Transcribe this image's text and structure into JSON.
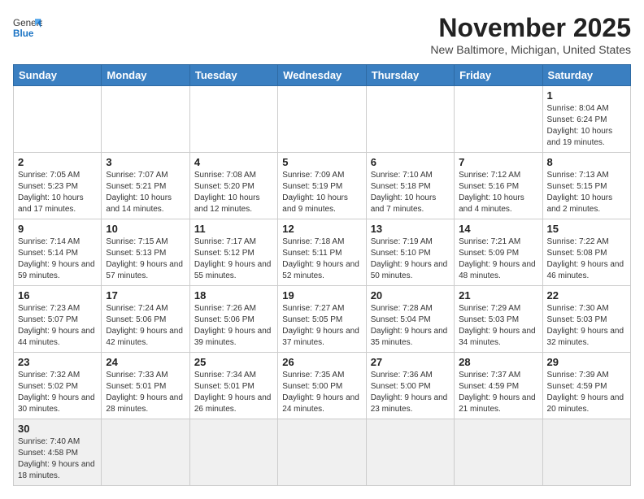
{
  "header": {
    "logo_text_normal": "General",
    "logo_text_bold": "Blue",
    "month": "November 2025",
    "location": "New Baltimore, Michigan, United States"
  },
  "weekdays": [
    "Sunday",
    "Monday",
    "Tuesday",
    "Wednesday",
    "Thursday",
    "Friday",
    "Saturday"
  ],
  "weeks": [
    [
      {
        "day": "",
        "info": ""
      },
      {
        "day": "",
        "info": ""
      },
      {
        "day": "",
        "info": ""
      },
      {
        "day": "",
        "info": ""
      },
      {
        "day": "",
        "info": ""
      },
      {
        "day": "",
        "info": ""
      },
      {
        "day": "1",
        "info": "Sunrise: 8:04 AM\nSunset: 6:24 PM\nDaylight: 10 hours and 19 minutes."
      }
    ],
    [
      {
        "day": "2",
        "info": "Sunrise: 7:05 AM\nSunset: 5:23 PM\nDaylight: 10 hours and 17 minutes."
      },
      {
        "day": "3",
        "info": "Sunrise: 7:07 AM\nSunset: 5:21 PM\nDaylight: 10 hours and 14 minutes."
      },
      {
        "day": "4",
        "info": "Sunrise: 7:08 AM\nSunset: 5:20 PM\nDaylight: 10 hours and 12 minutes."
      },
      {
        "day": "5",
        "info": "Sunrise: 7:09 AM\nSunset: 5:19 PM\nDaylight: 10 hours and 9 minutes."
      },
      {
        "day": "6",
        "info": "Sunrise: 7:10 AM\nSunset: 5:18 PM\nDaylight: 10 hours and 7 minutes."
      },
      {
        "day": "7",
        "info": "Sunrise: 7:12 AM\nSunset: 5:16 PM\nDaylight: 10 hours and 4 minutes."
      },
      {
        "day": "8",
        "info": "Sunrise: 7:13 AM\nSunset: 5:15 PM\nDaylight: 10 hours and 2 minutes."
      }
    ],
    [
      {
        "day": "9",
        "info": "Sunrise: 7:14 AM\nSunset: 5:14 PM\nDaylight: 9 hours and 59 minutes."
      },
      {
        "day": "10",
        "info": "Sunrise: 7:15 AM\nSunset: 5:13 PM\nDaylight: 9 hours and 57 minutes."
      },
      {
        "day": "11",
        "info": "Sunrise: 7:17 AM\nSunset: 5:12 PM\nDaylight: 9 hours and 55 minutes."
      },
      {
        "day": "12",
        "info": "Sunrise: 7:18 AM\nSunset: 5:11 PM\nDaylight: 9 hours and 52 minutes."
      },
      {
        "day": "13",
        "info": "Sunrise: 7:19 AM\nSunset: 5:10 PM\nDaylight: 9 hours and 50 minutes."
      },
      {
        "day": "14",
        "info": "Sunrise: 7:21 AM\nSunset: 5:09 PM\nDaylight: 9 hours and 48 minutes."
      },
      {
        "day": "15",
        "info": "Sunrise: 7:22 AM\nSunset: 5:08 PM\nDaylight: 9 hours and 46 minutes."
      }
    ],
    [
      {
        "day": "16",
        "info": "Sunrise: 7:23 AM\nSunset: 5:07 PM\nDaylight: 9 hours and 44 minutes."
      },
      {
        "day": "17",
        "info": "Sunrise: 7:24 AM\nSunset: 5:06 PM\nDaylight: 9 hours and 42 minutes."
      },
      {
        "day": "18",
        "info": "Sunrise: 7:26 AM\nSunset: 5:06 PM\nDaylight: 9 hours and 39 minutes."
      },
      {
        "day": "19",
        "info": "Sunrise: 7:27 AM\nSunset: 5:05 PM\nDaylight: 9 hours and 37 minutes."
      },
      {
        "day": "20",
        "info": "Sunrise: 7:28 AM\nSunset: 5:04 PM\nDaylight: 9 hours and 35 minutes."
      },
      {
        "day": "21",
        "info": "Sunrise: 7:29 AM\nSunset: 5:03 PM\nDaylight: 9 hours and 34 minutes."
      },
      {
        "day": "22",
        "info": "Sunrise: 7:30 AM\nSunset: 5:03 PM\nDaylight: 9 hours and 32 minutes."
      }
    ],
    [
      {
        "day": "23",
        "info": "Sunrise: 7:32 AM\nSunset: 5:02 PM\nDaylight: 9 hours and 30 minutes."
      },
      {
        "day": "24",
        "info": "Sunrise: 7:33 AM\nSunset: 5:01 PM\nDaylight: 9 hours and 28 minutes."
      },
      {
        "day": "25",
        "info": "Sunrise: 7:34 AM\nSunset: 5:01 PM\nDaylight: 9 hours and 26 minutes."
      },
      {
        "day": "26",
        "info": "Sunrise: 7:35 AM\nSunset: 5:00 PM\nDaylight: 9 hours and 24 minutes."
      },
      {
        "day": "27",
        "info": "Sunrise: 7:36 AM\nSunset: 5:00 PM\nDaylight: 9 hours and 23 minutes."
      },
      {
        "day": "28",
        "info": "Sunrise: 7:37 AM\nSunset: 4:59 PM\nDaylight: 9 hours and 21 minutes."
      },
      {
        "day": "29",
        "info": "Sunrise: 7:39 AM\nSunset: 4:59 PM\nDaylight: 9 hours and 20 minutes."
      }
    ],
    [
      {
        "day": "30",
        "info": "Sunrise: 7:40 AM\nSunset: 4:58 PM\nDaylight: 9 hours and 18 minutes."
      },
      {
        "day": "",
        "info": ""
      },
      {
        "day": "",
        "info": ""
      },
      {
        "day": "",
        "info": ""
      },
      {
        "day": "",
        "info": ""
      },
      {
        "day": "",
        "info": ""
      },
      {
        "day": "",
        "info": ""
      }
    ]
  ]
}
